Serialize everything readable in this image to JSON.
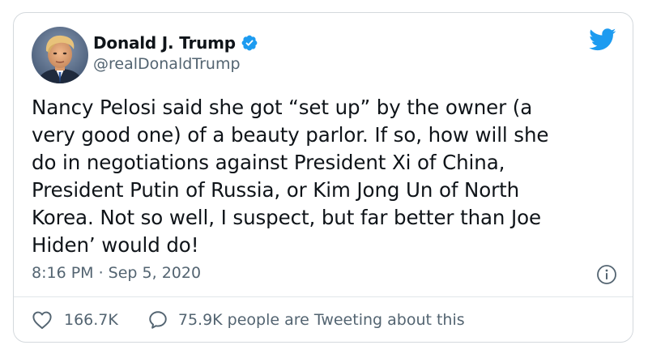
{
  "tweet": {
    "display_name": "Donald J. Trump",
    "handle": "@realDonaldTrump",
    "verified": true,
    "text": "Nancy Pelosi said she got “set up” by the owner (a\nvery good one) of a beauty parlor. If so, how will she\ndo in negotiations against President Xi of China,\nPresident Putin of Russia, or Kim Jong Un of North\nKorea. Not so well, I suspect, but far better than Joe\nHiden’ would do!",
    "timestamp": "8:16 PM · Sep 5, 2020",
    "like_count": "166.7K",
    "reply_text": "75.9K people are Tweeting about this"
  },
  "icons": {
    "logo": "twitter-bird-icon",
    "verified": "verified-badge-icon",
    "info": "info-icon",
    "like": "heart-icon",
    "reply": "speech-bubble-icon"
  },
  "colors": {
    "twitter_blue": "#1d9bf0",
    "text_primary": "#0f1419",
    "text_secondary": "#536471",
    "border": "#d4d9dd"
  }
}
